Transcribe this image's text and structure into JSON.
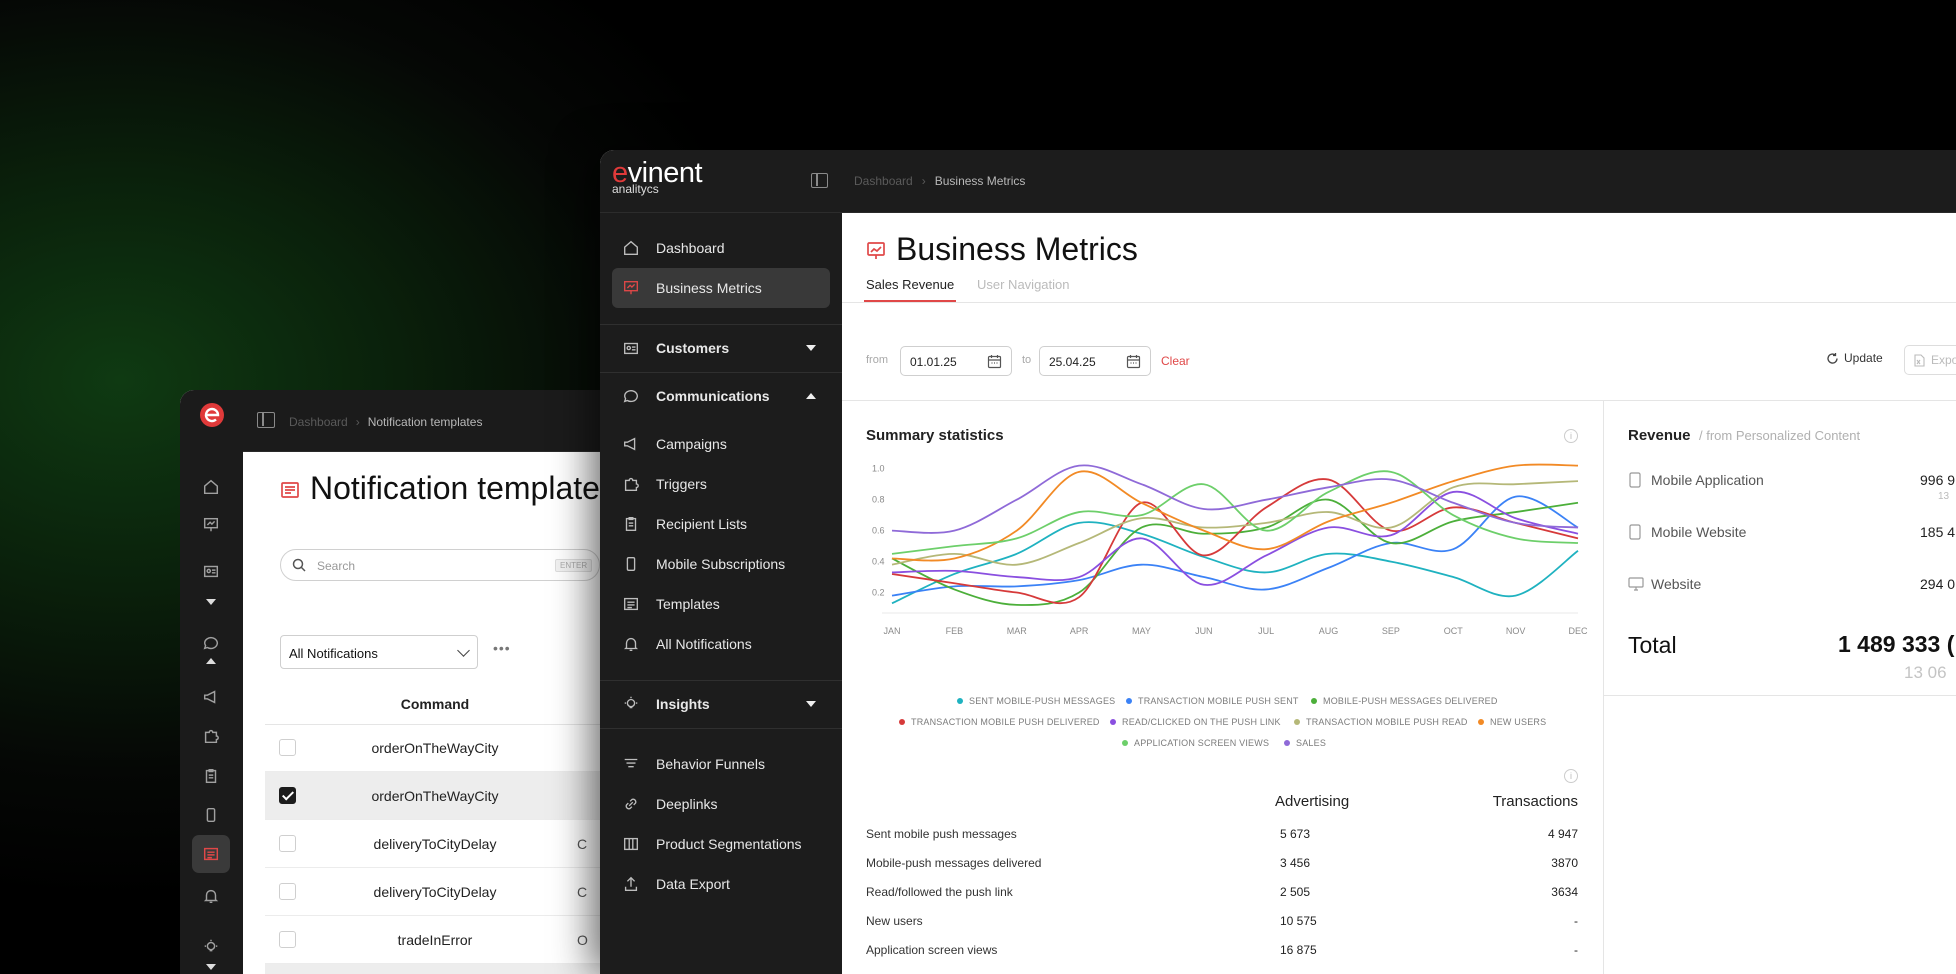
{
  "back_window": {
    "breadcrumb": [
      "Dashboard",
      "Notification templates"
    ],
    "page_title": "Notification templates",
    "search_placeholder": "Search",
    "search_hint": "ENTER",
    "filter_select": "All Notifications",
    "more_label": "•••",
    "column_command": "Command",
    "rows": [
      {
        "command": "orderOnTheWayCity",
        "checked": false,
        "trail": ""
      },
      {
        "command": "orderOnTheWayCity",
        "checked": true,
        "trail": ""
      },
      {
        "command": "deliveryToCityDelay",
        "checked": false,
        "trail": "C"
      },
      {
        "command": "deliveryToCityDelay",
        "checked": false,
        "trail": "C"
      },
      {
        "command": "tradeInError",
        "checked": false,
        "trail": "O"
      }
    ]
  },
  "front_window": {
    "logo_main": "vinent",
    "logo_e": "e",
    "logo_sub": "analitycs",
    "breadcrumb": [
      "Dashboard",
      "Business Metrics"
    ],
    "sidebar": {
      "items": [
        {
          "label": "Dashboard",
          "icon": "home-icon"
        },
        {
          "label": "Business Metrics",
          "icon": "presentation-chart-icon",
          "active": true
        },
        {
          "label": "Customers",
          "icon": "id-card-icon",
          "section": true
        },
        {
          "label": "Communications",
          "icon": "chat-bubble-icon",
          "section": true
        },
        {
          "label": "Campaigns",
          "icon": "megaphone-icon"
        },
        {
          "label": "Triggers",
          "icon": "puzzle-icon"
        },
        {
          "label": "Recipient Lists",
          "icon": "clipboard-icon"
        },
        {
          "label": "Mobile Subscriptions",
          "icon": "phone-icon"
        },
        {
          "label": "Templates",
          "icon": "newspaper-icon"
        },
        {
          "label": "All Notifications",
          "icon": "bell-icon"
        },
        {
          "label": "Insights",
          "icon": "lightbulb-icon",
          "section": true
        },
        {
          "label": "Behavior Funnels",
          "icon": "funnel-icon"
        },
        {
          "label": "Deeplinks",
          "icon": "link-icon"
        },
        {
          "label": "Product Segmentations",
          "icon": "grid-icon"
        },
        {
          "label": "Data Export",
          "icon": "upload-icon"
        }
      ]
    },
    "page_title": "Business Metrics",
    "tabs": [
      {
        "label": "Sales Revenue",
        "active": true
      },
      {
        "label": "User Navigation",
        "active": false
      }
    ],
    "filters": {
      "from_label": "from",
      "from_value": "01.01.25",
      "to_label": "to",
      "to_value": "25.04.25",
      "clear_label": "Clear",
      "update_label": "Update",
      "export_label": "Expo"
    },
    "summary": {
      "title": "Summary statistics",
      "table_headers": [
        "Advertising",
        "Transactions"
      ],
      "table_rows": [
        {
          "label": "Sent mobile push messages",
          "advertising": "5 673",
          "transactions": "4 947"
        },
        {
          "label": "Mobile-push messages delivered",
          "advertising": "3 456",
          "transactions": "3870"
        },
        {
          "label": "Read/followed the push link",
          "advertising": "2 505",
          "transactions": "3634"
        },
        {
          "label": "New users",
          "advertising": "10 575",
          "transactions": "-"
        },
        {
          "label": "Application screen views",
          "advertising": "16 875",
          "transactions": "-"
        }
      ]
    },
    "revenue": {
      "title": "Revenue",
      "subtitle": "/ from Personalized Content",
      "rows": [
        {
          "label": "Mobile Application",
          "icon": "phone-icon",
          "value": "996 9",
          "sub": "13"
        },
        {
          "label": "Mobile Website",
          "icon": "phone-icon",
          "value": "185 4",
          "sub": ""
        },
        {
          "label": "Website",
          "icon": "monitor-icon",
          "value": "294 0",
          "sub": ""
        }
      ],
      "total_label": "Total",
      "total_value": "1 489 333 (",
      "total_sub": "13 06"
    }
  },
  "chart_data": {
    "type": "line",
    "title": "Summary statistics",
    "categories": [
      "JAN",
      "FEB",
      "MAR",
      "APR",
      "MAY",
      "JUN",
      "JUL",
      "AUG",
      "SEP",
      "OCT",
      "NOV",
      "DEC"
    ],
    "ylim": [
      0.1,
      1.05
    ],
    "yticks": [
      "0.2",
      "0.4",
      "0.6",
      "0.8",
      "1.0"
    ],
    "grid": false,
    "legend_position": "bottom",
    "series": [
      {
        "name": "SENT MOBILE-PUSH MESSAGES",
        "color": "#1fb2c0",
        "values": [
          0.13,
          0.32,
          0.45,
          0.65,
          0.58,
          0.43,
          0.33,
          0.45,
          0.4,
          0.3,
          0.18,
          0.47
        ]
      },
      {
        "name": "TRANSACTION MOBILE PUSH SENT",
        "color": "#3b82f6",
        "values": [
          0.18,
          0.24,
          0.24,
          0.28,
          0.38,
          0.3,
          0.22,
          0.36,
          0.52,
          0.48,
          0.82,
          0.62
        ]
      },
      {
        "name": "MOBILE-PUSH MESSAGES DELIVERED",
        "color": "#4caf3a",
        "values": [
          0.42,
          0.22,
          0.12,
          0.2,
          0.62,
          0.58,
          0.62,
          0.8,
          0.52,
          0.66,
          0.72,
          0.78
        ]
      },
      {
        "name": "TRANSACTION MOBILE PUSH DELIVERED",
        "color": "#d63a3a",
        "values": [
          0.32,
          0.26,
          0.2,
          0.17,
          0.78,
          0.44,
          0.75,
          0.93,
          0.6,
          0.75,
          0.65,
          0.55
        ]
      },
      {
        "name": "READ/CLICKED ON THE PUSH LINK",
        "color": "#8a4fe0",
        "values": [
          0.33,
          0.34,
          0.3,
          0.3,
          0.55,
          0.25,
          0.44,
          0.62,
          0.57,
          0.85,
          0.68,
          0.58
        ]
      },
      {
        "name": "TRANSACTION MOBILE PUSH READ",
        "color": "#b5b878",
        "values": [
          0.38,
          0.45,
          0.38,
          0.52,
          0.68,
          0.62,
          0.65,
          0.72,
          0.62,
          0.88,
          0.9,
          0.92
        ]
      },
      {
        "name": "NEW USERS",
        "color": "#f28a25",
        "values": [
          0.42,
          0.42,
          0.6,
          0.98,
          0.78,
          0.6,
          0.48,
          0.66,
          0.78,
          0.92,
          1.02,
          1.02
        ]
      },
      {
        "name": "APPLICATION SCREEN VIEWS",
        "color": "#6dcf6a",
        "values": [
          0.45,
          0.5,
          0.55,
          0.72,
          0.7,
          0.9,
          0.6,
          0.85,
          0.98,
          0.7,
          0.55,
          0.52
        ]
      },
      {
        "name": "SALES",
        "color": "#8f6ad8",
        "values": [
          0.6,
          0.6,
          0.8,
          1.02,
          0.9,
          0.74,
          0.8,
          0.88,
          0.93,
          0.78,
          0.65,
          0.62
        ]
      }
    ]
  }
}
